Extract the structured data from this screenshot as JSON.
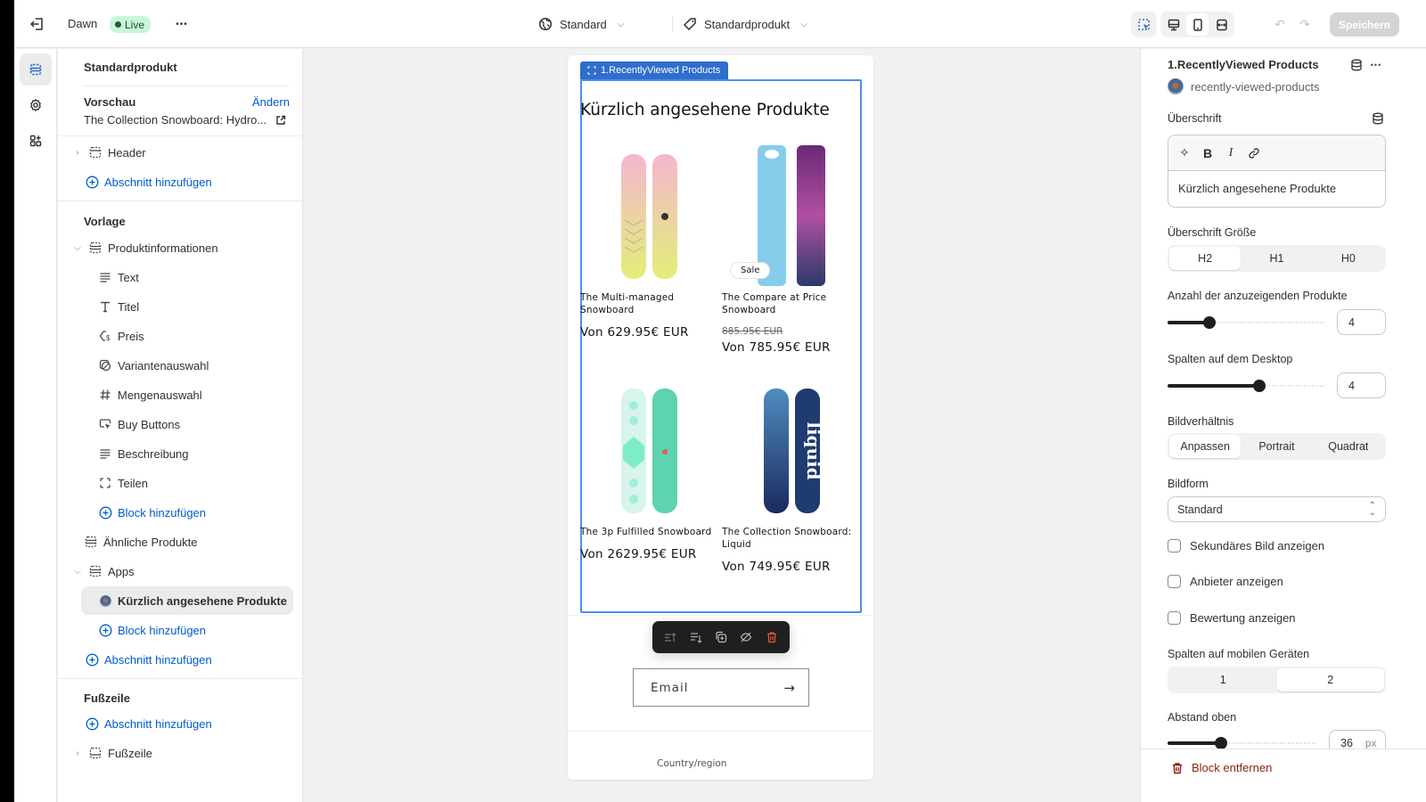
{
  "topbar": {
    "theme_name": "Dawn",
    "live_badge": "Live",
    "more_label": "•••",
    "market_select": "Standard",
    "template_select": "Standardprodukt",
    "save_label": "Speichern",
    "undo_icon": "↶",
    "redo_icon": "↷"
  },
  "left_panel": {
    "title": "Standardprodukt",
    "preview_label": "Vorschau",
    "change_link": "Ändern",
    "preview_value": "The Collection Snowboard: Hydro...",
    "header_item": "Header",
    "add_section": "Abschnitt hinzufügen",
    "template_label": "Vorlage",
    "product_info": "Produktinformationen",
    "blocks": [
      "Text",
      "Titel",
      "Preis",
      "Variantenauswahl",
      "Mengenauswahl",
      "Buy Buttons",
      "Beschreibung",
      "Teilen"
    ],
    "add_block": "Block hinzufügen",
    "related_products": "Ähnliche Produkte",
    "apps": "Apps",
    "recently_viewed": "Kürzlich angesehene Produkte",
    "footer_label": "Fußzeile",
    "footer_item": "Fußzeile"
  },
  "canvas": {
    "section_tag": "1.RecentlyViewed Products",
    "heading": "Kürzlich angesehene Produkte",
    "products": [
      {
        "title": "The Multi-managed Snowboard",
        "price": "Von 629.95€ EUR",
        "old_price": null,
        "sale": null
      },
      {
        "title": "The Compare at Price Snowboard",
        "price": "Von 785.95€ EUR",
        "old_price": "885.95€ EUR",
        "sale": "Sale"
      },
      {
        "title": "The 3p Fulfilled Snowboard",
        "price": "Von 2629.95€ EUR",
        "old_price": null,
        "sale": null
      },
      {
        "title": "The Collection Snowboard: Liquid",
        "price": "Von 749.95€ EUR",
        "old_price": null,
        "sale": null
      }
    ],
    "email_placeholder": "Email",
    "country_label": "Country/region"
  },
  "right_panel": {
    "title": "1.RecentlyViewed Products",
    "app_handle": "recently-viewed-products",
    "heading_label": "Überschrift",
    "heading_value": "Kürzlich angesehene Produkte",
    "heading_size_label": "Überschrift Größe",
    "heading_size_options": [
      "H2",
      "H1",
      "H0"
    ],
    "heading_size_selected": "H2",
    "products_count_label": "Anzahl der anzuzeigenden Produkte",
    "products_count_value": "4",
    "products_count_fraction": 0.27,
    "desktop_columns_label": "Spalten auf dem Desktop",
    "desktop_columns_value": "4",
    "desktop_columns_fraction": 0.59,
    "aspect_label": "Bildverhältnis",
    "aspect_options": [
      "Anpassen",
      "Portrait",
      "Quadrat"
    ],
    "aspect_selected": "Anpassen",
    "shape_label": "Bildform",
    "shape_value": "Standard",
    "checkboxes": [
      {
        "label": "Sekundäres Bild anzeigen",
        "checked": false
      },
      {
        "label": "Anbieter anzeigen",
        "checked": false
      },
      {
        "label": "Bewertung anzeigen",
        "checked": false
      }
    ],
    "mobile_columns_label": "Spalten auf mobilen Geräten",
    "mobile_columns_options": [
      "1",
      "2"
    ],
    "mobile_columns_selected": "2",
    "padding_top_label": "Abstand oben",
    "padding_top_value": "36",
    "padding_top_unit": "px",
    "padding_top_fraction": 0.36,
    "remove_block": "Block entfernen"
  },
  "colors": {
    "accent_blue": "#005bd3",
    "selection_blue": "#2f6ecc",
    "live_green": "#c8f7d6",
    "danger": "#8e1f0b"
  }
}
